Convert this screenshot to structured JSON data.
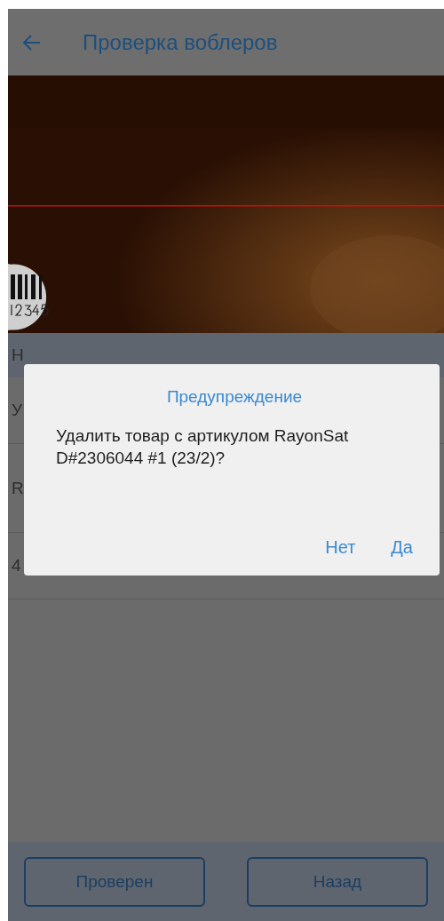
{
  "toolbar": {
    "title": "Проверка воблеров"
  },
  "camera": {
    "kind": "picture"
  },
  "list_header": {
    "text": "Н"
  },
  "rows": [
    {
      "text": "У"
    },
    {
      "text": "R"
    },
    {
      "text": "4"
    }
  ],
  "dialog": {
    "title": "Предупреждение",
    "message": "Удалить товар с артикулом RayonSat D#2306044 #1 (23/2)?",
    "buttons": [
      "Нет",
      "Да"
    ]
  },
  "bottom_buttons": [
    "Проверен",
    "Назад"
  ]
}
